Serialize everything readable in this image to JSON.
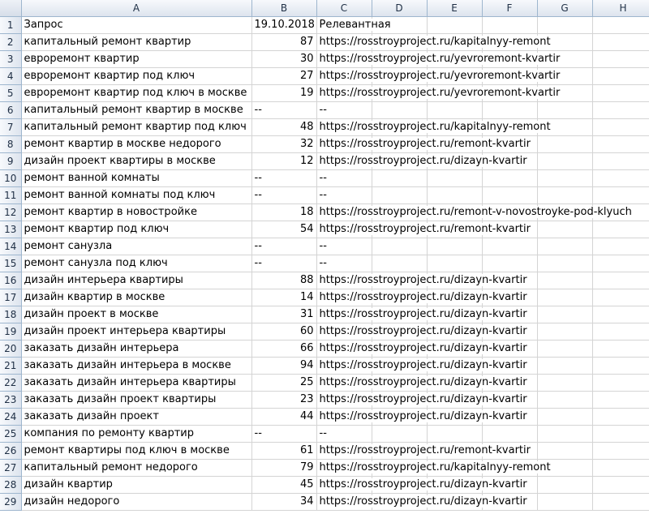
{
  "columns": [
    "A",
    "B",
    "C",
    "D",
    "E",
    "F",
    "G",
    "H"
  ],
  "header_row": {
    "row": "1",
    "a": "Запрос",
    "b": "19.10.2018",
    "c": "Релевантная"
  },
  "rows": [
    {
      "row": "2",
      "a": "капитальный ремонт квартир",
      "b": "87",
      "c": "https://rosstroyproject.ru/kapitalnyy-remont"
    },
    {
      "row": "3",
      "a": "евроремонт квартир",
      "b": "30",
      "c": "https://rosstroyproject.ru/yevroremont-kvartir"
    },
    {
      "row": "4",
      "a": "евроремонт квартир под ключ",
      "b": "27",
      "c": "https://rosstroyproject.ru/yevroremont-kvartir"
    },
    {
      "row": "5",
      "a": "евроремонт квартир под ключ в москве",
      "b": "19",
      "c": "https://rosstroyproject.ru/yevroremont-kvartir"
    },
    {
      "row": "6",
      "a": "капитальный ремонт квартир в москве",
      "b": "--",
      "c": "--"
    },
    {
      "row": "7",
      "a": "капитальный ремонт квартир под ключ",
      "b": "48",
      "c": "https://rosstroyproject.ru/kapitalnyy-remont"
    },
    {
      "row": "8",
      "a": "ремонт квартир в москве недорого",
      "b": "32",
      "c": "https://rosstroyproject.ru/remont-kvartir"
    },
    {
      "row": "9",
      "a": "дизайн проект квартиры в москве",
      "b": "12",
      "c": "https://rosstroyproject.ru/dizayn-kvartir"
    },
    {
      "row": "10",
      "a": "ремонт ванной комнаты",
      "b": "--",
      "c": "--"
    },
    {
      "row": "11",
      "a": "ремонт ванной комнаты под ключ",
      "b": "--",
      "c": "--"
    },
    {
      "row": "12",
      "a": "ремонт квартир в новостройке",
      "b": "18",
      "c": "https://rosstroyproject.ru/remont-v-novostroyke-pod-klyuch"
    },
    {
      "row": "13",
      "a": "ремонт квартир под ключ",
      "b": "54",
      "c": "https://rosstroyproject.ru/remont-kvartir"
    },
    {
      "row": "14",
      "a": "ремонт санузла",
      "b": "--",
      "c": "--"
    },
    {
      "row": "15",
      "a": "ремонт санузла под ключ",
      "b": "--",
      "c": "--"
    },
    {
      "row": "16",
      "a": "дизайн интерьера квартиры",
      "b": "88",
      "c": "https://rosstroyproject.ru/dizayn-kvartir"
    },
    {
      "row": "17",
      "a": "дизайн квартир в москве",
      "b": "14",
      "c": "https://rosstroyproject.ru/dizayn-kvartir"
    },
    {
      "row": "18",
      "a": "дизайн проект в москве",
      "b": "31",
      "c": "https://rosstroyproject.ru/dizayn-kvartir"
    },
    {
      "row": "19",
      "a": "дизайн проект интерьера квартиры",
      "b": "60",
      "c": "https://rosstroyproject.ru/dizayn-kvartir"
    },
    {
      "row": "20",
      "a": "заказать дизайн интерьера",
      "b": "66",
      "c": "https://rosstroyproject.ru/dizayn-kvartir"
    },
    {
      "row": "21",
      "a": "заказать дизайн интерьера в москве",
      "b": "94",
      "c": "https://rosstroyproject.ru/dizayn-kvartir"
    },
    {
      "row": "22",
      "a": "заказать дизайн интерьера квартиры",
      "b": "25",
      "c": "https://rosstroyproject.ru/dizayn-kvartir"
    },
    {
      "row": "23",
      "a": "заказать дизайн проект квартиры",
      "b": "23",
      "c": "https://rosstroyproject.ru/dizayn-kvartir"
    },
    {
      "row": "24",
      "a": "заказать дизайн проект",
      "b": "44",
      "c": "https://rosstroyproject.ru/dizayn-kvartir"
    },
    {
      "row": "25",
      "a": "компания по ремонту квартир",
      "b": "--",
      "c": "--"
    },
    {
      "row": "26",
      "a": "ремонт квартиры под ключ в москве",
      "b": "61",
      "c": "https://rosstroyproject.ru/remont-kvartir"
    },
    {
      "row": "27",
      "a": "капитальный ремонт недорого",
      "b": "79",
      "c": "https://rosstroyproject.ru/kapitalnyy-remont"
    },
    {
      "row": "28",
      "a": "дизайн квартир",
      "b": "45",
      "c": "https://rosstroyproject.ru/dizayn-kvartir"
    },
    {
      "row": "29",
      "a": "дизайн недорого",
      "b": "34",
      "c": "https://rosstroyproject.ru/dizayn-kvartir"
    }
  ],
  "colors": {
    "header_bg": "#dde4ee",
    "header_border": "#9eb6ce",
    "gridline": "#d4d4d4"
  }
}
